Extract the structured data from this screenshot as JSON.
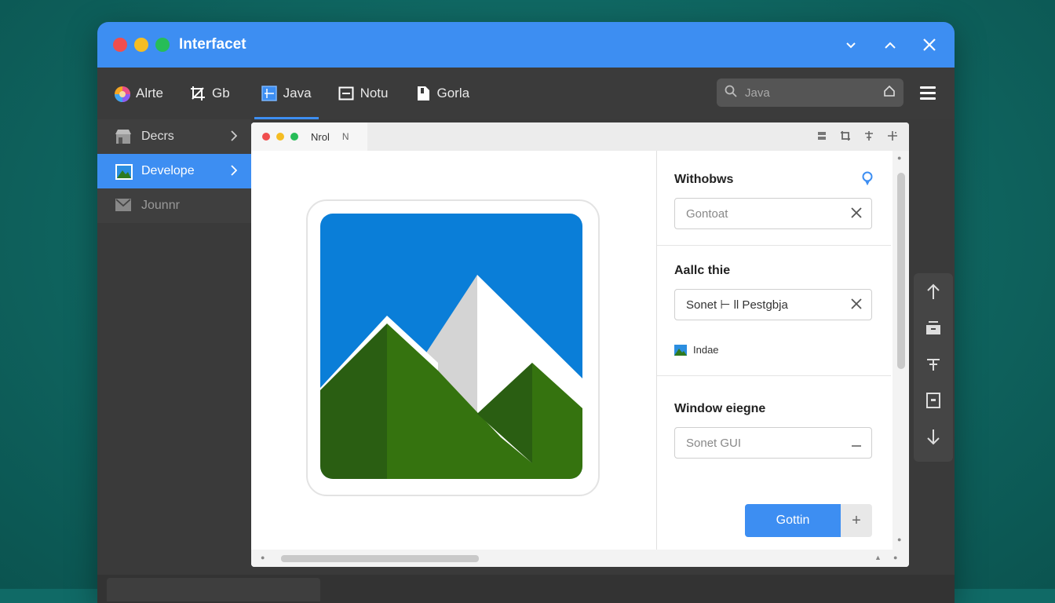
{
  "window": {
    "title": "Interfacet",
    "controls": {
      "minimize_icon": "chevron-down-icon",
      "maximize_icon": "chevron-up-icon",
      "close_icon": "close-icon"
    },
    "traffic_colors": [
      "#f04e4e",
      "#f5bd23",
      "#27bd58"
    ]
  },
  "menubar": {
    "items": [
      {
        "label": "Alrte",
        "icon": "color-wheel-icon"
      },
      {
        "label": "Gb",
        "icon": "crop-tool-icon"
      },
      {
        "label": "Java",
        "icon": "grid-window-icon",
        "active": true
      },
      {
        "label": "Notu",
        "icon": "panel-window-icon"
      },
      {
        "label": "Gorla",
        "icon": "document-icon"
      }
    ],
    "search": {
      "placeholder": "Java"
    }
  },
  "sidebar": {
    "items": [
      {
        "label": "Decrs",
        "icon": "storefront-icon"
      },
      {
        "label": "Develope",
        "icon": "image-icon",
        "active": true
      },
      {
        "label": "Jounnr",
        "icon": "mail-icon"
      }
    ]
  },
  "inner": {
    "tab": {
      "label": "Nrol",
      "close": "N"
    },
    "image": {
      "icon": "mountain-image-icon"
    },
    "sections": [
      {
        "title": "Withobws",
        "input_placeholder": "Gontoat"
      },
      {
        "title": "Aallc thie",
        "input_value": "Sonet ⊢ ll Pestgbja",
        "link": "Indae"
      },
      {
        "title": "Window  eiegne",
        "input_placeholder": "Sonet GUI"
      }
    ],
    "primary_button": "Gottin",
    "add_button": "+"
  },
  "colors": {
    "accent": "#3d8ef2",
    "titlebar": "#3d8ef2",
    "background": "#106a66"
  }
}
